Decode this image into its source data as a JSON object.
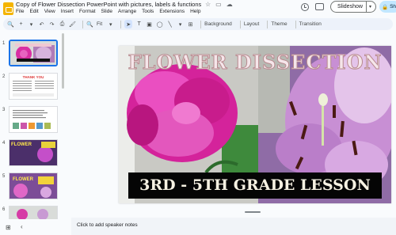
{
  "document": {
    "title": "Copy of Flower Dissection PowerPoint with pictures, labels & functions"
  },
  "title_icons": [
    "star-icon",
    "move-to-folder-icon",
    "cloud-saved-icon"
  ],
  "menu": [
    "File",
    "Edit",
    "View",
    "Insert",
    "Format",
    "Slide",
    "Arrange",
    "Tools",
    "Extensions",
    "Help"
  ],
  "header": {
    "slideshow_label": "Slideshow",
    "slideshow_arrow": "▾",
    "share_label": "Sh"
  },
  "toolbar": {
    "search": "🔍",
    "add": "+",
    "add_arrow": "▾",
    "undo": "↶",
    "redo": "↷",
    "print": "⎙",
    "paint_format": "🖌",
    "zoom_icon": "🔍",
    "zoom_label": "Fit",
    "zoom_arrow": "▾",
    "select": "➤",
    "text_box": "T",
    "image": "▣",
    "shape": "◯",
    "line": "╲",
    "line_arrow": "▾",
    "comment": "⊞",
    "background_label": "Background",
    "layout_label": "Layout",
    "theme_label": "Theme",
    "transition_label": "Transition"
  },
  "filmstrip": {
    "slides": [
      {
        "number": "1"
      },
      {
        "number": "2",
        "heading": "THANK YOU"
      },
      {
        "number": "3"
      },
      {
        "number": "4",
        "text": "FLOWER"
      },
      {
        "number": "5",
        "text": "FLOWER"
      },
      {
        "number": "6"
      }
    ]
  },
  "slide": {
    "title": "FLOWER DISSECTION",
    "subtitle": "3RD - 5TH GRADE LESSON"
  },
  "notes": {
    "placeholder": "Click to add speaker notes"
  },
  "bottom": {
    "grid_icon": "⊞",
    "collapse_icon": "‹"
  },
  "colors": {
    "accent": "#1a73e8",
    "toolbar_bg": "#edf2fa",
    "share_bg": "#c2e7ff",
    "title_fill": "#f5e6ea",
    "subtitle_fill": "#f6f1e2"
  }
}
